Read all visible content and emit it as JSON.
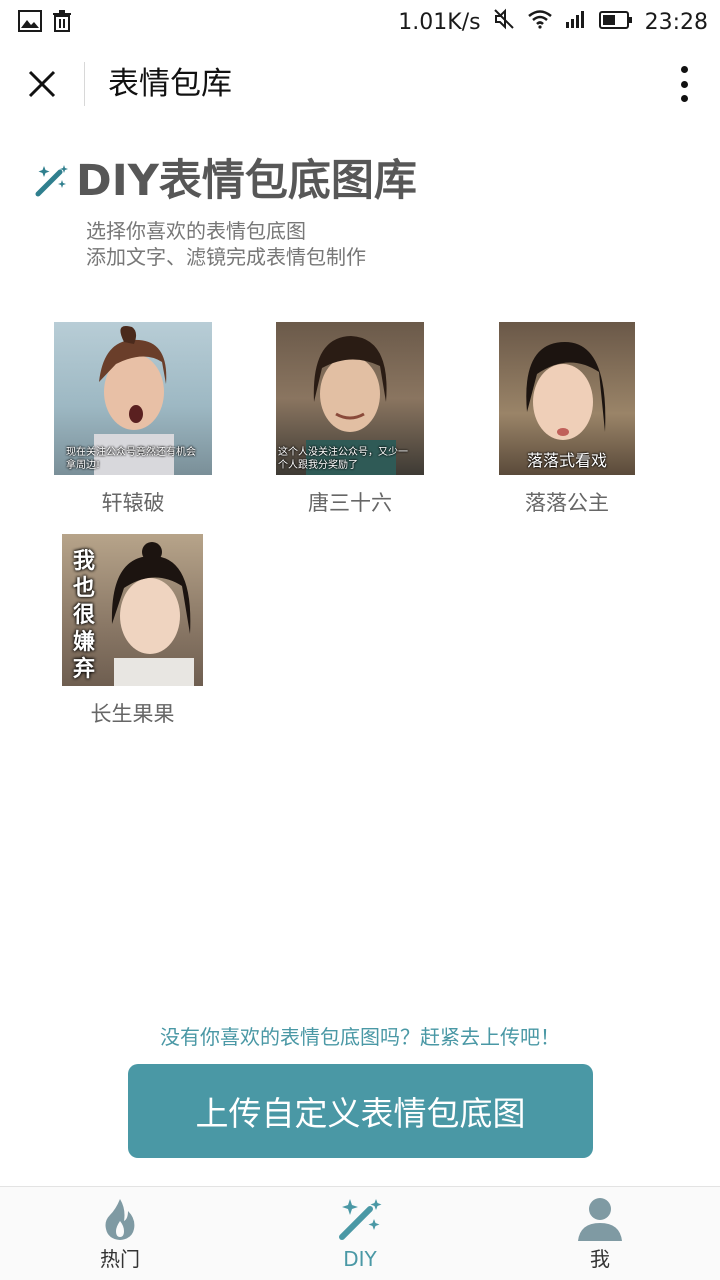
{
  "status_bar": {
    "speed": "1.01K/s",
    "time": "23:28",
    "icons": [
      "image-icon",
      "trash-icon",
      "mute-icon",
      "wifi-icon",
      "signal-icon",
      "battery-icon"
    ]
  },
  "title_bar": {
    "title": "表情包库",
    "close_icon": "close-icon",
    "more_icon": "more-vertical-icon"
  },
  "banner": {
    "title": "DIY表情包底图库",
    "subtitle_line1": "选择你喜欢的表情包底图",
    "subtitle_line2": "添加文字、滤镜完成表情包制作",
    "icon": "magic-wand-icon"
  },
  "templates": [
    {
      "name": "轩辕破",
      "caption": "现在关注公众号竟然还有机会拿周边!"
    },
    {
      "name": "唐三十六",
      "caption": "这个人没关注公众号，又少一个人跟我分奖励了"
    },
    {
      "name": "落落公主",
      "caption": "落落式看戏"
    },
    {
      "name": "长生果果",
      "caption": "我也很嫌弃"
    }
  ],
  "upload": {
    "hint": "没有你喜欢的表情包底图吗？赶紧去上传吧！",
    "button_label": "上传自定义表情包底图"
  },
  "bottom_nav": {
    "items": [
      {
        "label": "热门",
        "icon": "flame-icon",
        "active": false
      },
      {
        "label": "DIY",
        "icon": "magic-wand-icon",
        "active": true
      },
      {
        "label": "我",
        "icon": "user-icon",
        "active": false
      }
    ]
  },
  "colors": {
    "accent": "#4a98a5",
    "banner_title": "#575757",
    "nav_icon": "#7f9aa3"
  }
}
